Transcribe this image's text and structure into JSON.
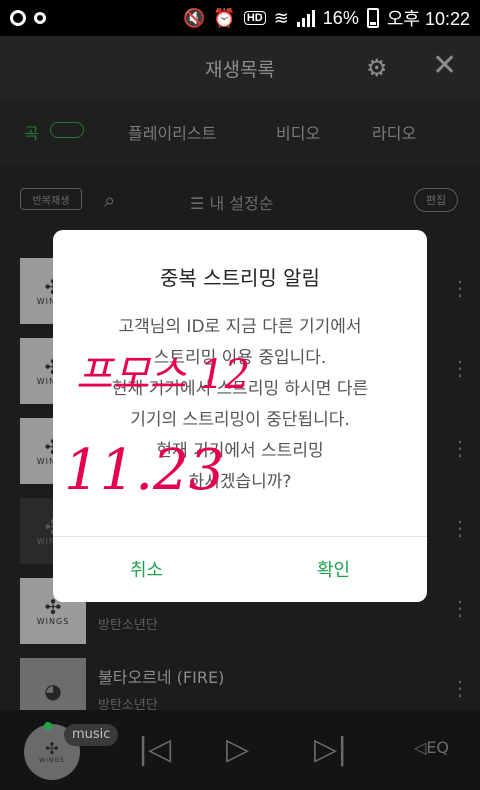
{
  "status_bar": {
    "battery": "16%",
    "time": "오후 10:22"
  },
  "header": {
    "title": "재생목록",
    "icons": [
      "gear-icon",
      "close-icon"
    ]
  },
  "tabs": [
    {
      "label": "곡",
      "active": true
    },
    {
      "label": "플레이리스트",
      "active": false
    },
    {
      "label": "비디오",
      "active": false
    },
    {
      "label": "라디오",
      "active": false
    }
  ],
  "toolbar": {
    "repeat_label": "반복재생",
    "sort_label": "내 설정순",
    "edit_label": "편집"
  },
  "list": {
    "rows": [
      {
        "title": "",
        "artist": "",
        "art": "WINGS"
      },
      {
        "title": "",
        "artist": "",
        "art": "WINGS"
      },
      {
        "title": "",
        "artist": "",
        "art": "WINGS"
      },
      {
        "title": "",
        "artist": "",
        "art": "WINGS"
      },
      {
        "title": "",
        "artist": "방탄소년단",
        "art": "WINGS"
      },
      {
        "title": "불타오르네 (FIRE)",
        "artist": "방탄소년단",
        "art": "fire"
      }
    ]
  },
  "player": {
    "tag": "music",
    "eq_label": "EQ"
  },
  "dialog": {
    "title": "중복 스트리밍 알림",
    "message_lines": [
      "고객님의 ID로 지금 다른 기기에서",
      "스트리밍 이용 중입니다.",
      "현재 기기에서 스트리밍 하시면 다른",
      "기기의 스트리밍이 중단됩니다.",
      "현재 기기에서 스트리밍",
      "하시겠습니까?"
    ],
    "cancel_label": "취소",
    "confirm_label": "확인",
    "accent": "#1aa14a"
  },
  "handwriting": {
    "line1": "프모스 12",
    "line2": "11.23"
  }
}
